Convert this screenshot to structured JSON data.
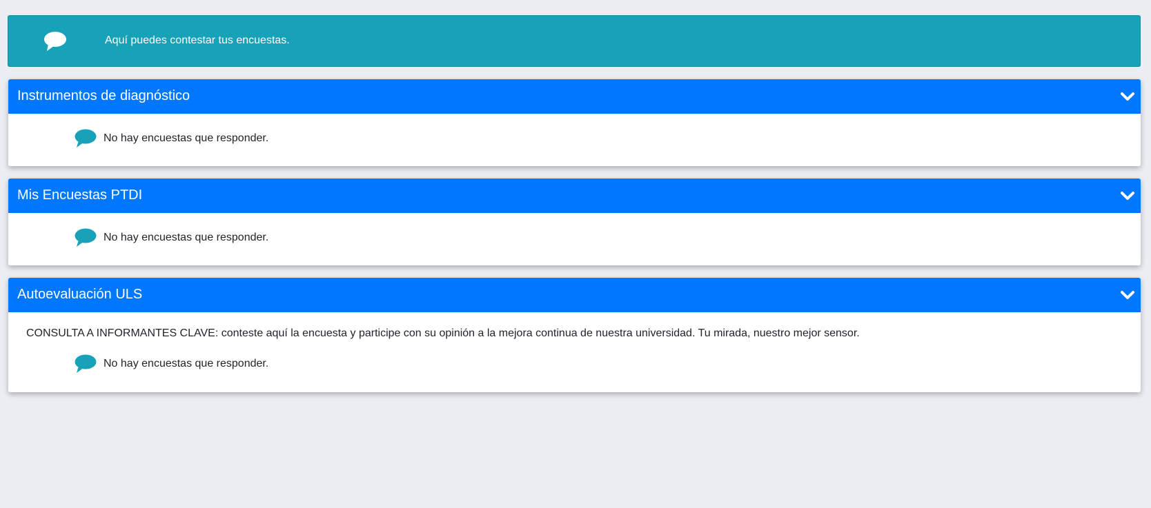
{
  "banner": {
    "text": "Aquí puedes contestar tus encuestas.",
    "icon": "comment-icon"
  },
  "sections": [
    {
      "title": "Instrumentos de diagnóstico",
      "empty_message": "No hay encuestas que responder."
    },
    {
      "title": "Mis Encuestas PTDI",
      "empty_message": "No hay encuestas que responder."
    },
    {
      "title": "Autoevaluación ULS",
      "description": "CONSULTA A INFORMANTES CLAVE: conteste aquí la encuesta y participe con su opinión a la mejora continua de nuestra universidad. Tu mirada, nuestro mejor sensor.",
      "empty_message": "No hay encuestas que responder."
    }
  ],
  "colors": {
    "banner": "#17a2b8",
    "header": "#0077ff",
    "icon": "#17a2b8",
    "page_bg": "#eaedf2"
  }
}
